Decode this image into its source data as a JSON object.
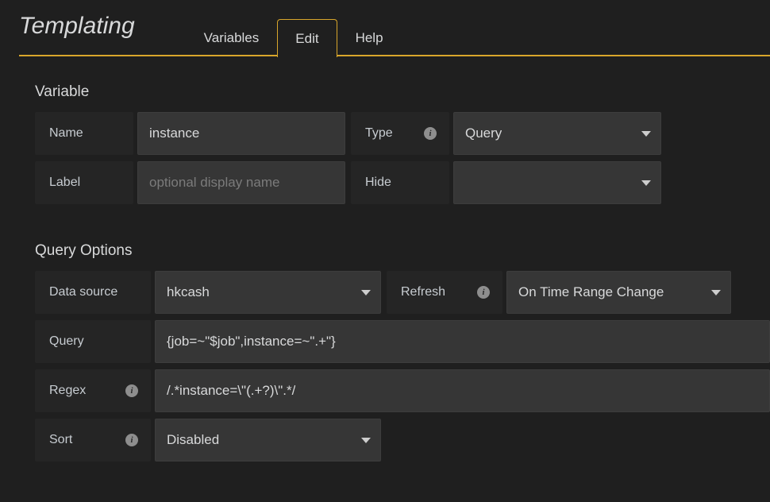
{
  "header": {
    "title": "Templating",
    "tabs": [
      {
        "label": "Variables",
        "active": false
      },
      {
        "label": "Edit",
        "active": true
      },
      {
        "label": "Help",
        "active": false
      }
    ],
    "accent_color": "#d8a62b"
  },
  "variable_section": {
    "heading": "Variable",
    "name": {
      "label": "Name",
      "value": "instance"
    },
    "type": {
      "label": "Type",
      "value": "Query",
      "has_info": true
    },
    "label_field": {
      "label": "Label",
      "value": "",
      "placeholder": "optional display name"
    },
    "hide": {
      "label": "Hide",
      "value": ""
    }
  },
  "query_options_section": {
    "heading": "Query Options",
    "data_source": {
      "label": "Data source",
      "value": "hkcash"
    },
    "refresh": {
      "label": "Refresh",
      "value": "On Time Range Change",
      "has_info": true
    },
    "query": {
      "label": "Query",
      "value": "{job=~\"$job\",instance=~\".+\"}"
    },
    "regex": {
      "label": "Regex",
      "value": "/.*instance=\\\"(.+?)\\\".*/",
      "has_info": true
    },
    "sort": {
      "label": "Sort",
      "value": "Disabled",
      "has_info": true
    }
  },
  "icons": {
    "info": "i",
    "info_icon_name": "info-icon",
    "caret_icon_name": "chevron-down-icon"
  },
  "colors": {
    "page_background": "#1f1f1f",
    "label_background": "#252525",
    "field_background": "#363636",
    "text": "#d8d9da",
    "placeholder": "#7b7b7b",
    "accent": "#d8a62b"
  }
}
